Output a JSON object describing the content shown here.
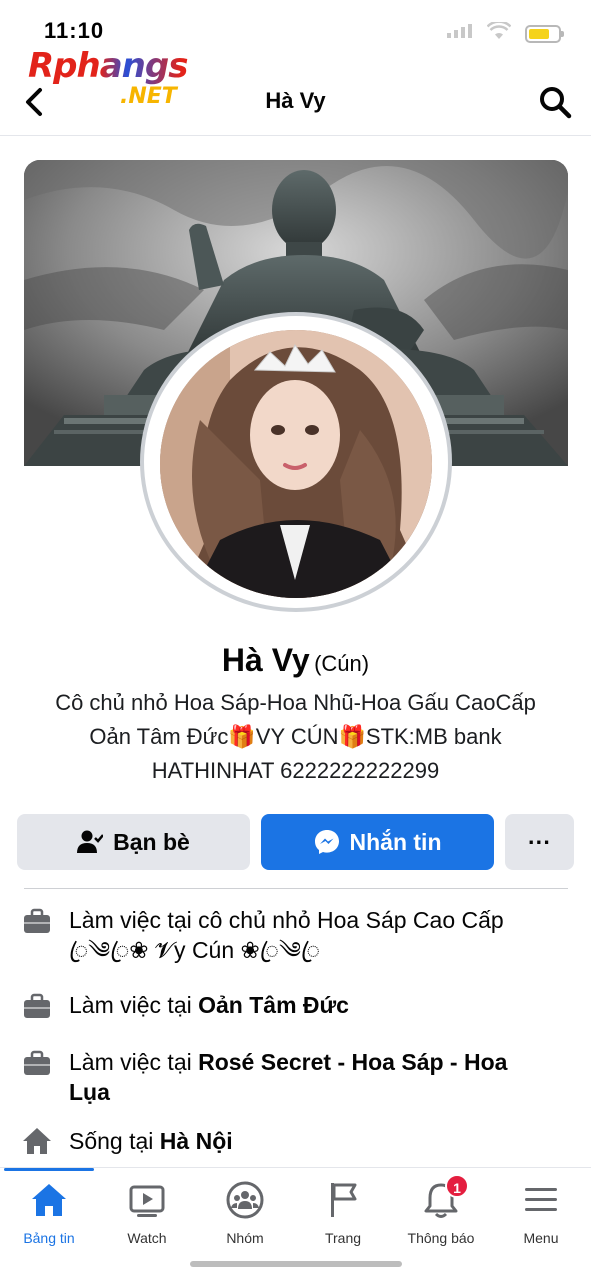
{
  "status_bar": {
    "time": "11:10",
    "battery_color": "#f5d31b"
  },
  "watermark": {
    "line1": "Rphangs",
    "line2": ".NET"
  },
  "nav": {
    "title": "Hà Vy"
  },
  "profile": {
    "name": "Hà Vy",
    "alt_name": "(Cún)",
    "bio_lines": [
      "Cô chủ nhỏ Hoa Sáp-Hoa Nhũ-Hoa Gấu CaoCấp",
      "Oản Tâm Đức🎁VY CÚN🎁STK:MB bank",
      "HATHINHAT 6222222222299"
    ]
  },
  "actions": {
    "friends_label": "Bạn bè",
    "message_label": "Nhắn tin",
    "more_label": "···"
  },
  "info": [
    {
      "icon": "briefcase-icon",
      "prefix": "Làm việc tại ",
      "value": "cô chủ nhỏ Hoa Sáp Cao Cấp",
      "line2": "ꦿ༄ꦿ❀ 𝓥y Cún ❀ꦿ༄ꦿ",
      "bold": false
    },
    {
      "icon": "briefcase-icon",
      "prefix": "Làm việc tại ",
      "value": "Oản Tâm Đức",
      "bold": true
    },
    {
      "icon": "briefcase-icon",
      "prefix": "Làm việc tại ",
      "value": "Rosé Secret - Hoa Sáp - Hoa",
      "line2": "Lụa",
      "bold": true
    },
    {
      "icon": "house-icon",
      "prefix": "Sống tại ",
      "value": "Hà Nội",
      "bold": true
    }
  ],
  "tabs": [
    {
      "label": "Bảng tin",
      "icon": "home-icon",
      "active": true
    },
    {
      "label": "Watch",
      "icon": "watch-video-icon",
      "active": false
    },
    {
      "label": "Nhóm",
      "icon": "groups-icon",
      "active": false
    },
    {
      "label": "Trang",
      "icon": "flag-icon",
      "active": false
    },
    {
      "label": "Thông báo",
      "icon": "bell-icon",
      "active": false,
      "badge": "1"
    },
    {
      "label": "Menu",
      "icon": "hamburger-icon",
      "active": false
    }
  ],
  "colors": {
    "accent": "#1b74e4",
    "badge": "#e41e3f",
    "button_gray": "#e4e6eb"
  }
}
